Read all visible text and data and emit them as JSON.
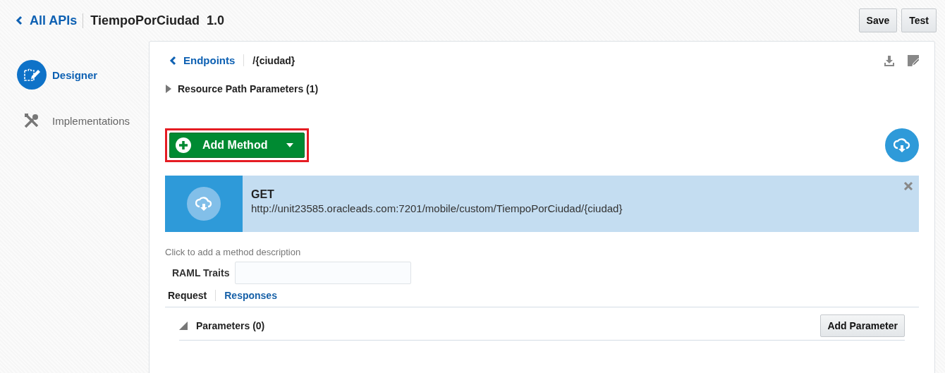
{
  "header": {
    "back_link": "All APIs",
    "api_name": "TiempoPorCiudad",
    "version": "1.0",
    "buttons": [
      "Save",
      "Test"
    ]
  },
  "sidebar": {
    "items": [
      {
        "label": "Designer",
        "selected": true
      },
      {
        "label": "Implementations",
        "selected": false
      }
    ]
  },
  "breadcrumb": {
    "back_link": "Endpoints",
    "path": "/{ciudad}"
  },
  "resource_path_parameters": {
    "label": "Resource Path Parameters (1)",
    "expanded": false
  },
  "add_method_button": "Add Method",
  "method": {
    "verb": "GET",
    "url": "http://unit23585.oracleads.com:7201/mobile/custom/TiempoPorCiudad/{ciudad}",
    "description_placeholder": "Click to add a method description",
    "raml_traits_label": "RAML Traits"
  },
  "tabs": [
    {
      "label": "Request",
      "selected": true
    },
    {
      "label": "Responses",
      "selected": false
    }
  ],
  "parameters": {
    "label": "Parameters (0)",
    "expanded": true,
    "add_button": "Add Parameter"
  }
}
